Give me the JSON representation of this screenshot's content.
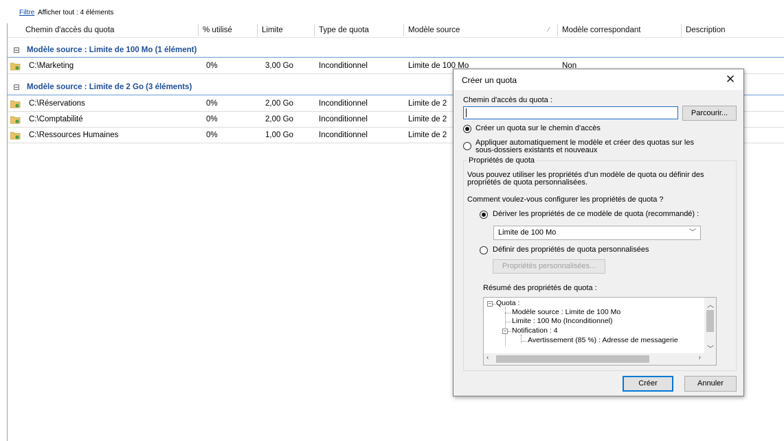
{
  "filterbar": {
    "filter_link": "Filtre",
    "summary": "Afficher tout : 4 éléments"
  },
  "columns": [
    "Chemin d'accès du quota",
    "% utilisé",
    "Limite",
    "Type de quota",
    "Modèle source",
    "Modèle correspondant",
    "Description"
  ],
  "groups": [
    {
      "title": "Modèle source : Limite de 100 Mo (1 élément)",
      "rows": [
        {
          "path": "C:\\Marketing",
          "used": "0%",
          "limit": "3,00 Go",
          "type": "Inconditionnel",
          "source": "Limite de 100 Mo",
          "match": "Non",
          "desc": ""
        }
      ]
    },
    {
      "title": "Modèle source : Limite de 2 Go (3 éléments)",
      "rows": [
        {
          "path": "C:\\Réservations",
          "used": "0%",
          "limit": "2,00 Go",
          "type": "Inconditionnel",
          "source": "Limite de 2",
          "match": "",
          "desc": ""
        },
        {
          "path": "C:\\Comptabilité",
          "used": "0%",
          "limit": "2,00 Go",
          "type": "Inconditionnel",
          "source": "Limite de 2",
          "match": "",
          "desc": ""
        },
        {
          "path": "C:\\Ressources Humaines",
          "used": "0%",
          "limit": "1,00 Go",
          "type": "Inconditionnel",
          "source": "Limite de 2",
          "match": "",
          "desc": ""
        }
      ]
    }
  ],
  "dialog": {
    "title": "Créer un quota",
    "path_label": "Chemin d'accès du quota :",
    "path_value": "",
    "browse_label": "Parcourir...",
    "radio_create": "Créer un quota sur le chemin d'accès",
    "radio_auto_line1": "Appliquer automatiquement le modèle et créer des quotas sur les",
    "radio_auto_line2": "sous-dossiers existants et nouveaux",
    "props_group": "Propriétés de quota",
    "props_desc_line1": "Vous pouvez utiliser les propriétés d'un modèle de quota ou définir des",
    "props_desc_line2": "propriétés de quota personnalisées.",
    "question": "Comment voulez-vous configurer les propriétés de quota ?",
    "radio_derive": "Dériver les propriétés de ce modèle de quota (recommandé) :",
    "template_selected": "Limite de 100 Mo",
    "radio_custom": "Définir des propriétés de quota personnalisées",
    "custom_button": "Propriétés personnalisées...",
    "summary_label": "Résumé des propriétés de quota :",
    "tree": {
      "root": "Quota :",
      "source": "Modèle source : Limite de 100 Mo",
      "limit": "Limite : 100 Mo (Inconditionnel)",
      "notification": "Notification : 4",
      "warning": "Avertissement (85 %) : Adresse de messagerie"
    },
    "create_button": "Créer",
    "cancel_button": "Annuler"
  }
}
